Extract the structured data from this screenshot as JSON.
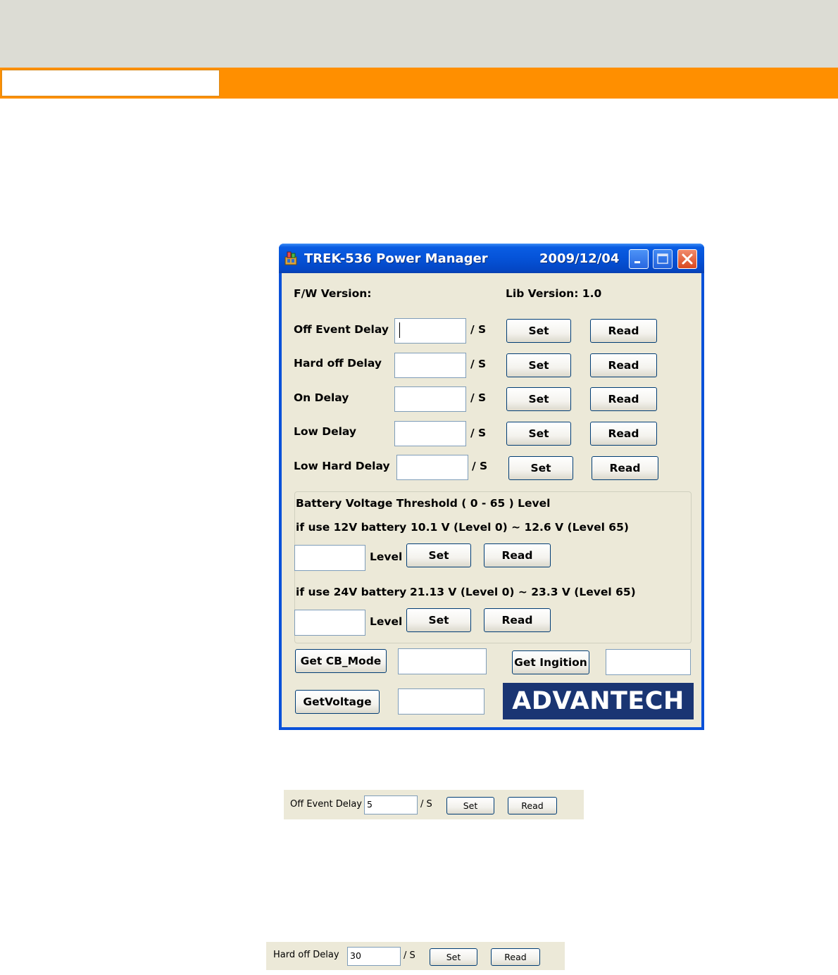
{
  "window": {
    "title": "TREK-536 Power Manager",
    "date": "2009/12/04"
  },
  "fw_version_label": "F/W Version:",
  "lib_version_label": "Lib Version: 1.0",
  "delay_rows": [
    {
      "label": "Off Event  Delay",
      "value": "",
      "unit": "/ S",
      "set": "Set",
      "read": "Read"
    },
    {
      "label": "Hard off  Delay",
      "value": "",
      "unit": "/ S",
      "set": "Set",
      "read": "Read"
    },
    {
      "label": "On  Delay",
      "value": "",
      "unit": "/ S",
      "set": "Set",
      "read": "Read"
    },
    {
      "label": "Low  Delay",
      "value": "",
      "unit": "/ S",
      "set": "Set",
      "read": "Read"
    },
    {
      "label": "Low Hard  Delay",
      "value": "",
      "unit": "/ S",
      "set": "Set",
      "read": "Read"
    }
  ],
  "battery": {
    "title": "Battery Voltage Threshold  ( 0 - 65 ) Level",
    "v12_label": "if use 12V battery",
    "v12_range": "10.1 V (Level 0)  ~  12.6 V (Level 65)",
    "v24_label": "if use 24V battery",
    "v24_range": "21.13 V (Level 0)  ~  23.3 V (Level 65)",
    "level_label": "Level",
    "set": "Set",
    "read": "Read"
  },
  "bottom": {
    "get_cb_mode": "Get CB_Mode",
    "get_ingition": "Get Ingition",
    "get_voltage": "GetVoltage"
  },
  "logo_text": "ADVANTECH",
  "snippets": [
    {
      "label": "Off Event  Delay",
      "value": "5",
      "unit": "/ S",
      "set": "Set",
      "read": "Read"
    },
    {
      "label": "Hard off  Delay",
      "value": "30",
      "unit": "/ S",
      "set": "Set",
      "read": "Read"
    }
  ],
  "colors": {
    "orange_bar": "#ff8f00",
    "titlebar_blue": "#0553d8",
    "dialog_bg": "#ece9d8",
    "logo_bg": "#1a3573"
  }
}
